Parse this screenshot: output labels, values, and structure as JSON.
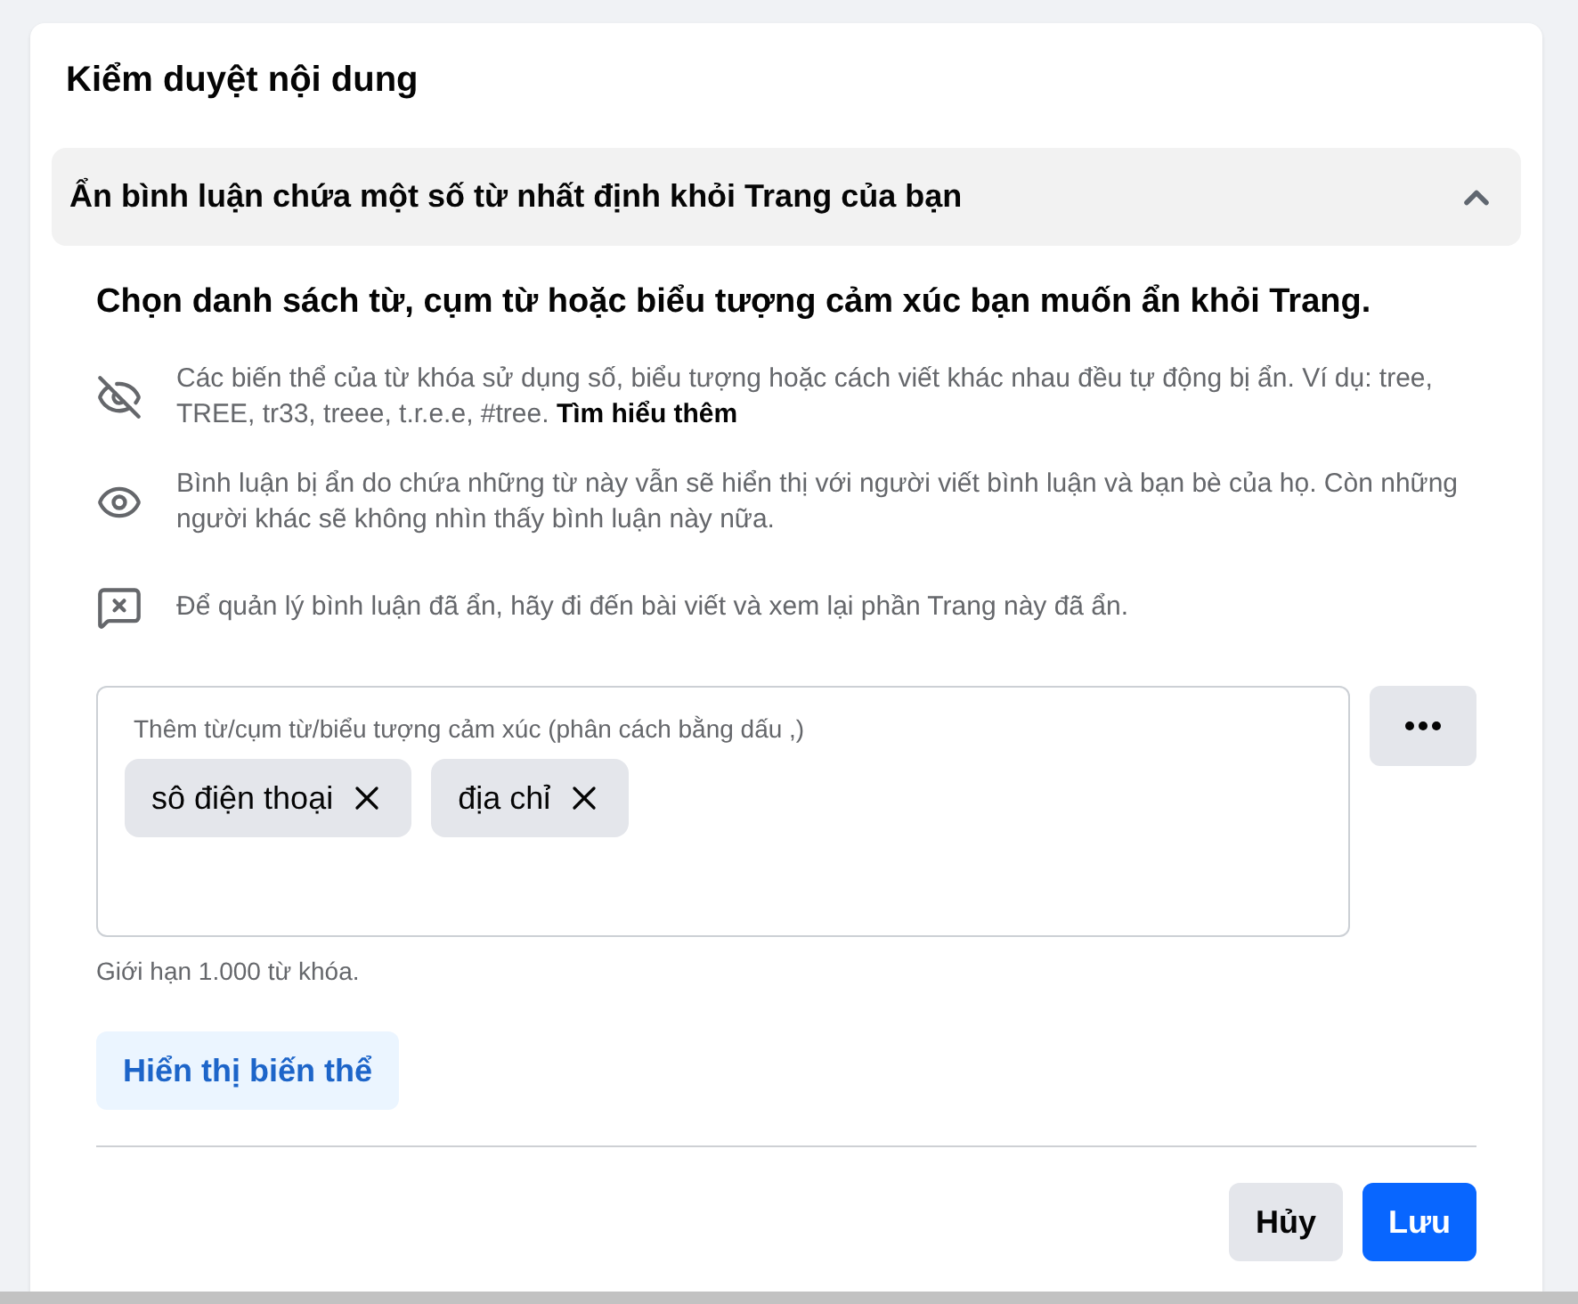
{
  "panel": {
    "title": "Kiểm duyệt nội dung"
  },
  "section": {
    "title": "Ẩn bình luận chứa một số từ nhất định khỏi Trang của bạn",
    "expanded": true,
    "heading": "Chọn danh sách từ, cụm từ hoặc biểu tượng cảm xúc bạn muốn ẩn khỏi Trang.",
    "notes": [
      {
        "text": "Các biến thể của từ khóa sử dụng số, biểu tượng hoặc cách viết khác nhau đều tự động bị ẩn. Ví dụ: tree, TREE, tr33, treee, t.r.e.e, #tree.",
        "link": "Tìm hiểu thêm"
      },
      {
        "text": "Bình luận bị ẩn do chứa những từ này vẫn sẽ hiển thị với người viết bình luận và bạn bè của họ. Còn những người khác sẽ không nhìn thấy bình luận này nữa."
      },
      {
        "text": "Để quản lý bình luận đã ẩn, hãy đi đến bài viết và xem lại phần Trang này đã ẩn."
      }
    ],
    "keyword_field": {
      "label": "Thêm từ/cụm từ/biểu tượng cảm xúc (phân cách bằng dấu ,)",
      "chips": [
        "sô điện thoại",
        "địa chỉ"
      ]
    },
    "limit_note": "Giới hạn 1.000 từ khóa.",
    "variants_button": "Hiển thị biến thể"
  },
  "actions": [
    {
      "label": "Hủy",
      "kind": "secondary"
    },
    {
      "label": "Lưu",
      "kind": "primary"
    }
  ]
}
